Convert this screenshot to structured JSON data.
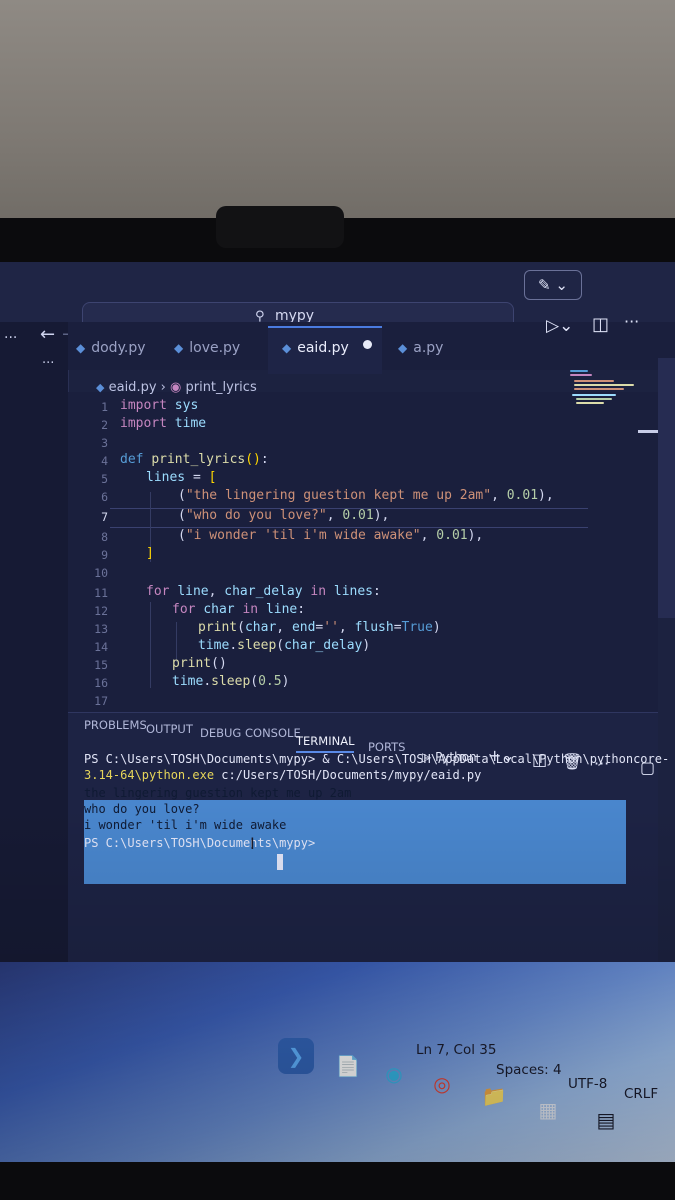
{
  "titlebar": {
    "search_text": "mypy"
  },
  "tabs": [
    {
      "label": "dody.py"
    },
    {
      "label": "love.py"
    },
    {
      "label": "eaid.py",
      "active": true
    },
    {
      "label": "a.py"
    }
  ],
  "breadcrumb": {
    "file": "eaid.py",
    "symbol": "print_lyrics"
  },
  "editor": {
    "line_numbers": [
      "1",
      "2",
      "3",
      "4",
      "5",
      "6",
      "7",
      "8",
      "9",
      "10",
      "11",
      "12",
      "13",
      "14",
      "15",
      "16",
      "17"
    ],
    "current_line": 7
  },
  "panel": {
    "tabs": [
      "PROBLEMS",
      "OUTPUT",
      "DEBUG CONSOLE",
      "TERMINAL",
      "PORTS"
    ],
    "active_tab": "TERMINAL",
    "shell_label": "Python",
    "terminal": {
      "prompt": "PS C:\\Users\\TOSH\\Documents\\mypy>",
      "cmd_part1": " & C:\\Users\\TOSH\\AppData\\Local\\Python\\pythoncore-",
      "cmd_part2_hl": "3.14-64\\python.exe",
      "cmd_part3": " c:/Users/TOSH/Documents/mypy/eaid.py",
      "out1": "the lingering guestion kept me up 2am",
      "out2": "who do you love?",
      "out3": "i wonder 'til i'm wide awake",
      "prompt2": "PS C:\\Users\\TOSH\\Documents\\mypy>"
    }
  },
  "statusbar": {
    "position": "Ln 7, Col 35",
    "spaces": "Spaces: 4",
    "encoding": "UTF-8",
    "eol": "CRLF"
  }
}
